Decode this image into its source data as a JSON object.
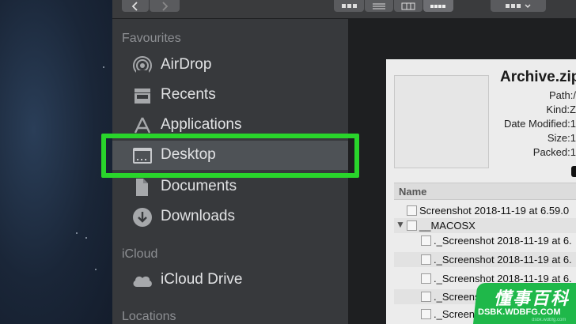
{
  "sidebar": {
    "favourites_title": "Favourites",
    "icloud_title": "iCloud",
    "locations_title": "Locations",
    "items": [
      {
        "label": "AirDrop",
        "icon": "airdrop-icon"
      },
      {
        "label": "Recents",
        "icon": "recents-icon"
      },
      {
        "label": "Applications",
        "icon": "applications-icon"
      },
      {
        "label": "Desktop",
        "icon": "desktop-icon",
        "selected": true
      },
      {
        "label": "Documents",
        "icon": "documents-icon"
      },
      {
        "label": "Downloads",
        "icon": "downloads-icon"
      }
    ],
    "icloud_items": [
      {
        "label": "iCloud Drive",
        "icon": "cloud-icon"
      }
    ]
  },
  "preview": {
    "title": "Archive.zip",
    "meta": [
      {
        "label": "Path:",
        "value": "/"
      },
      {
        "label": "Kind:",
        "value": "Z"
      },
      {
        "label": "Date Modified:",
        "value": "1"
      },
      {
        "label": "Size:",
        "value": "1"
      },
      {
        "label": "Packed:",
        "value": "1"
      }
    ],
    "column_header": "Name",
    "rows": [
      {
        "text": "Screenshot 2018-11-19 at 6.59.0",
        "indent": 0
      },
      {
        "text": "__MACOSX",
        "indent": 0,
        "folder": true
      },
      {
        "text": "._Screenshot 2018-11-19 at 6.",
        "indent": 1
      },
      {
        "text": "._Screenshot 2018-11-19 at 6.",
        "indent": 1
      },
      {
        "text": "._Screenshot 2018-11-19 at 6.",
        "indent": 1
      },
      {
        "text": "._Screens",
        "indent": 1
      },
      {
        "text": "._Screens",
        "indent": 1
      }
    ]
  },
  "watermark": {
    "main": "懂事百科",
    "sub": "DSBK.WDBFG.COM",
    "tiny": "dsbk.wdbfg.com"
  },
  "colors": {
    "highlight": "#29d52b",
    "sidebar_bg": "#37393c",
    "selected_bg": "#4e5256"
  }
}
